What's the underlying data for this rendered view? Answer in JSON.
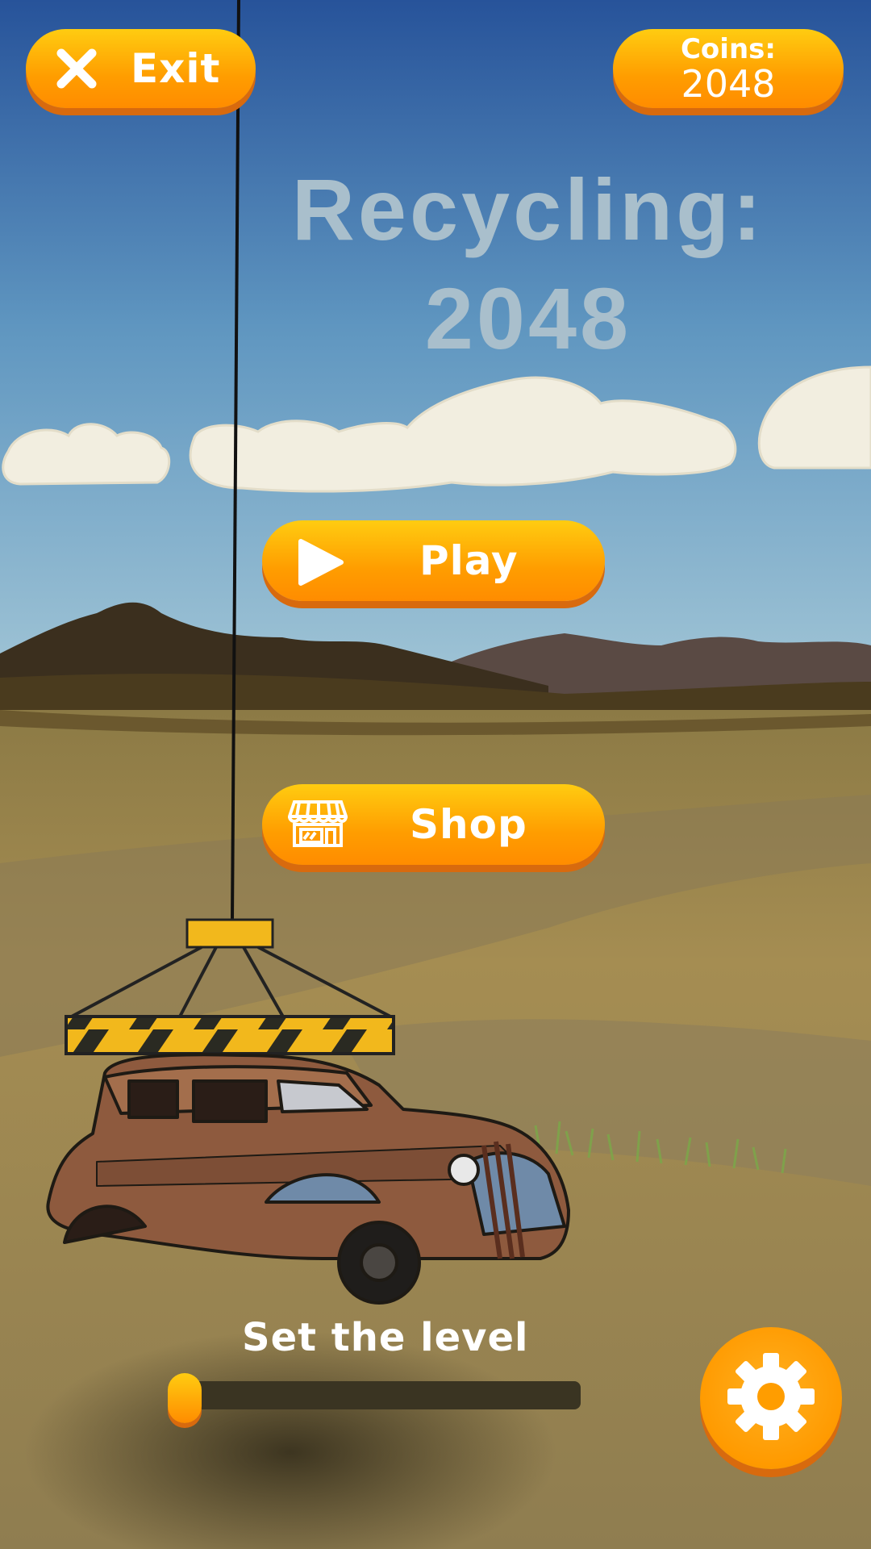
{
  "header": {
    "exit_label": "Exit",
    "coins_label": "Coins:",
    "coins_value": "2048"
  },
  "title": {
    "line1": "Recycling:",
    "line2": "2048"
  },
  "menu": {
    "play_label": "Play",
    "shop_label": "Shop"
  },
  "level": {
    "label": "Set the level",
    "slider_value": 0
  },
  "icons": {
    "exit": "close-icon",
    "play": "play-icon",
    "shop": "shop-icon",
    "settings": "gear-icon"
  },
  "colors": {
    "button": "#ff9d00",
    "button_shadow": "#d86a0e",
    "title": "#a9bfcc",
    "sky_top": "#27539a",
    "sky_bottom": "#9ec4d6",
    "ground": "#a38a52"
  }
}
